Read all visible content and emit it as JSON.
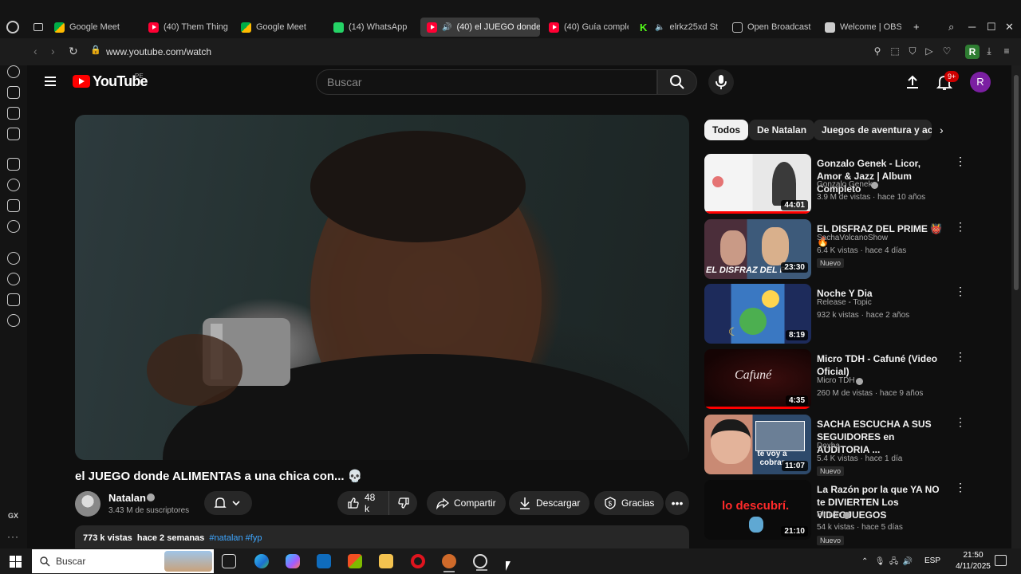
{
  "browser": {
    "tabs": [
      {
        "label": "Google Meet",
        "icon": "google-meet-icon"
      },
      {
        "label": "(40) Them Thing",
        "icon": "youtube-icon"
      },
      {
        "label": "Google Meet",
        "icon": "google-meet-icon"
      },
      {
        "label": "(14) WhatsApp",
        "icon": "whatsapp-icon"
      },
      {
        "label": "(40) el JUEGO donde",
        "icon": "youtube-icon",
        "active": true
      },
      {
        "label": "(40) Guía comple",
        "icon": "youtube-icon"
      },
      {
        "label": "elrkz25xd St",
        "icon": "kick-icon"
      },
      {
        "label": "Open Broadcast",
        "icon": "obs-icon"
      },
      {
        "label": "Welcome | OBS",
        "icon": "document-icon"
      }
    ],
    "url": "www.youtube.com/watch",
    "kick_letter": "K",
    "profile_letter": "R"
  },
  "sidebar": {
    "gx_label": "GX",
    "more_label": "···"
  },
  "header": {
    "logo_text": "YouTube",
    "country": "PE",
    "search_placeholder": "Buscar",
    "notification_count": "9+",
    "avatar_letter": "R"
  },
  "video": {
    "title": "el JUEGO donde ALIMENTAS a una chica con... 💀",
    "channel": "Natalan",
    "subscribers": "3.43 M de suscriptores",
    "likes": "48 k",
    "share_label": "Compartir",
    "download_label": "Descargar",
    "thanks_label": "Gracias",
    "views": "773 k vistas",
    "date": "hace 2 semanas",
    "hashtags": "#natalan #fyp"
  },
  "chips": [
    "Todos",
    "De Natalan",
    "Juegos de aventura y acci"
  ],
  "recommendations": [
    {
      "title": "Gonzalo Genek - Licor, Amor & Jazz | Album Completo",
      "channel": "Gonzalo Genek",
      "verified": true,
      "meta": "3.9 M de vistas · hace 10 años",
      "duration": "44:01",
      "new": ""
    },
    {
      "title": "EL DISFRAZ DEL PRIME 👹🔥",
      "channel": "SachaVolcanoShow",
      "verified": false,
      "meta": "6.4 K vistas · hace 4 días",
      "duration": "23:30",
      "new": "Nuevo",
      "thumb_caption": "EL DISFRAZ DEL P"
    },
    {
      "title": "Noche Y Dia",
      "channel": "Release - Topic",
      "verified": false,
      "meta": "932 k vistas · hace 2 años",
      "duration": "8:19",
      "new": ""
    },
    {
      "title": "Micro TDH - Cafuné (Video Oficial)",
      "channel": "Micro TDH",
      "verified": true,
      "meta": "260 M de vistas · hace 9 años",
      "duration": "4:35",
      "new": "",
      "thumb_caption": "Cafuné"
    },
    {
      "title": "SACHA ESCUCHA A SUS SEGUIDORES en AUDITORIA ...",
      "channel": "Doxha",
      "verified": false,
      "meta": "5.4 K vistas · hace 1 día",
      "duration": "11:07",
      "new": "Nuevo",
      "thumb_caption": "te voy a cobrar"
    },
    {
      "title": "La Razón por la que YA NO te DIVIERTEN Los VIDEOJUEGOS",
      "channel": "Pinwin",
      "verified": true,
      "meta": "54 k vistas · hace 5 días",
      "duration": "21:10",
      "new": "Nuevo",
      "thumb_caption": "lo descubrí."
    }
  ],
  "taskbar": {
    "search_placeholder": "Buscar",
    "language": "ESP",
    "time": "21:50",
    "date": "4/11/2025"
  }
}
